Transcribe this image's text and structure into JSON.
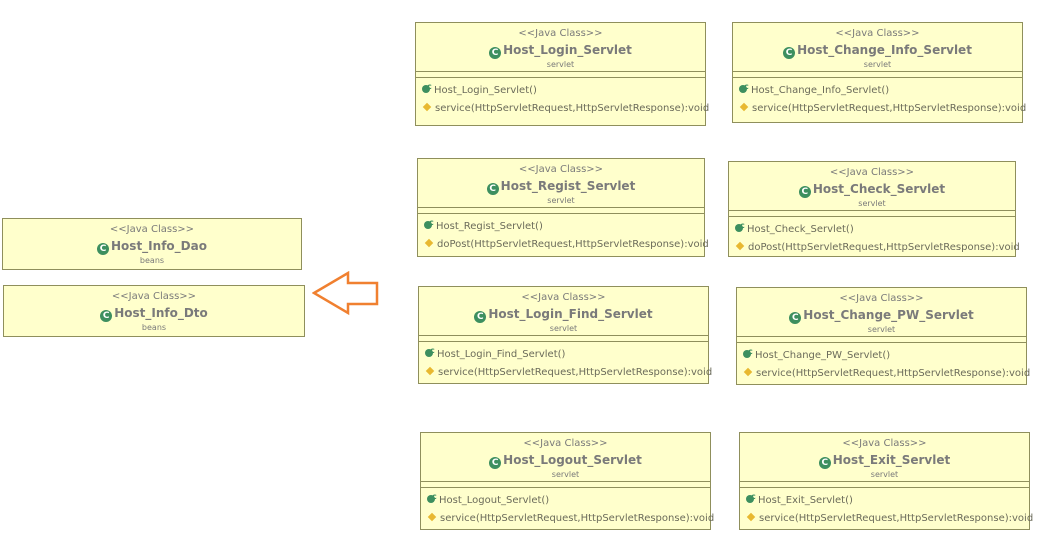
{
  "stereotype": "<<Java Class>>",
  "classes": [
    {
      "name": "Host_Login_Servlet",
      "package": "servlet",
      "constructor": "Host_Login_Servlet()",
      "method": "service(HttpServletRequest,HttpServletResponse):void"
    },
    {
      "name": "Host_Change_Info_Servlet",
      "package": "servlet",
      "constructor": "Host_Change_Info_Servlet()",
      "method": "service(HttpServletRequest,HttpServletResponse):void"
    },
    {
      "name": "Host_Regist_Servlet",
      "package": "servlet",
      "constructor": "Host_Regist_Servlet()",
      "method": "doPost(HttpServletRequest,HttpServletResponse):void"
    },
    {
      "name": "Host_Check_Servlet",
      "package": "servlet",
      "constructor": "Host_Check_Servlet()",
      "method": "doPost(HttpServletRequest,HttpServletResponse):void"
    },
    {
      "name": "Host_Login_Find_Servlet",
      "package": "servlet",
      "constructor": "Host_Login_Find_Servlet()",
      "method": "service(HttpServletRequest,HttpServletResponse):void"
    },
    {
      "name": "Host_Change_PW_Servlet",
      "package": "servlet",
      "constructor": "Host_Change_PW_Servlet()",
      "method": "service(HttpServletRequest,HttpServletResponse):void"
    },
    {
      "name": "Host_Logout_Servlet",
      "package": "servlet",
      "constructor": "Host_Logout_Servlet()",
      "method": "service(HttpServletRequest,HttpServletResponse):void"
    },
    {
      "name": "Host_Exit_Servlet",
      "package": "servlet",
      "constructor": "Host_Exit_Servlet()",
      "method": "service(HttpServletRequest,HttpServletResponse):void"
    }
  ],
  "beans": [
    {
      "name": "Host_Info_Dao",
      "package": "beans"
    },
    {
      "name": "Host_Info_Dto",
      "package": "beans"
    }
  ],
  "colors": {
    "box_fill": "#ffffcc",
    "box_border": "#8f8f5c",
    "class_icon": "#3d8f5f",
    "method_icon": "#e8b830",
    "arrow": "#f08030"
  }
}
